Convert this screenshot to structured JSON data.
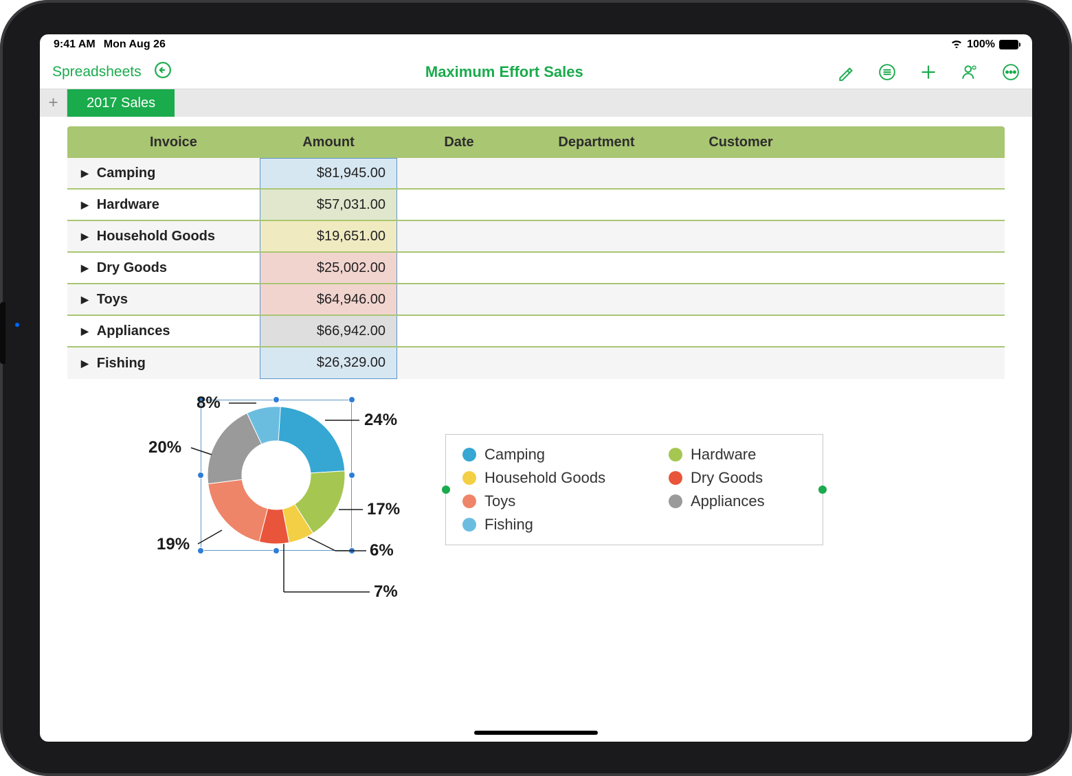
{
  "status": {
    "time": "9:41 AM",
    "date": "Mon Aug 26",
    "battery": "100%"
  },
  "toolbar": {
    "back": "Spreadsheets",
    "title": "Maximum Effort Sales"
  },
  "tabs": {
    "active": "2017 Sales"
  },
  "table": {
    "headers": [
      "Invoice",
      "Amount",
      "Date",
      "Department",
      "Customer"
    ],
    "rows": [
      {
        "category": "Camping",
        "amount": "$81,945.00",
        "fill": "#d7e7f2"
      },
      {
        "category": "Hardware",
        "amount": "$57,031.00",
        "fill": "#e0e7cc"
      },
      {
        "category": "Household Goods",
        "amount": "$19,651.00",
        "fill": "#f0eac1"
      },
      {
        "category": "Dry Goods",
        "amount": "$25,002.00",
        "fill": "#f2d4cf"
      },
      {
        "category": "Toys",
        "amount": "$64,946.00",
        "fill": "#f2d4cf"
      },
      {
        "category": "Appliances",
        "amount": "$66,942.00",
        "fill": "#dedede"
      },
      {
        "category": "Fishing",
        "amount": "$26,329.00",
        "fill": "#d7e7f2"
      }
    ]
  },
  "chart_data": {
    "type": "pie",
    "title": "",
    "series": [
      {
        "name": "Camping",
        "pct": 24,
        "color": "#35a7d2"
      },
      {
        "name": "Hardware",
        "pct": 17,
        "color": "#a5c651"
      },
      {
        "name": "Household Goods",
        "pct": 6,
        "color": "#f3cf45"
      },
      {
        "name": "Dry Goods",
        "pct": 7,
        "color": "#e9553b"
      },
      {
        "name": "Toys",
        "pct": 19,
        "color": "#ee8568"
      },
      {
        "name": "Appliances",
        "pct": 20,
        "color": "#9a9a9a"
      },
      {
        "name": "Fishing",
        "pct": 8,
        "color": "#6bbde0"
      }
    ],
    "legend_order": [
      "Camping",
      "Hardware",
      "Household Goods",
      "Dry Goods",
      "Toys",
      "Appliances",
      "Fishing"
    ]
  },
  "callouts": {
    "camping": "24%",
    "hardware": "17%",
    "household": "6%",
    "drygoods": "7%",
    "toys": "19%",
    "appliances": "20%",
    "fishing": "8%"
  }
}
